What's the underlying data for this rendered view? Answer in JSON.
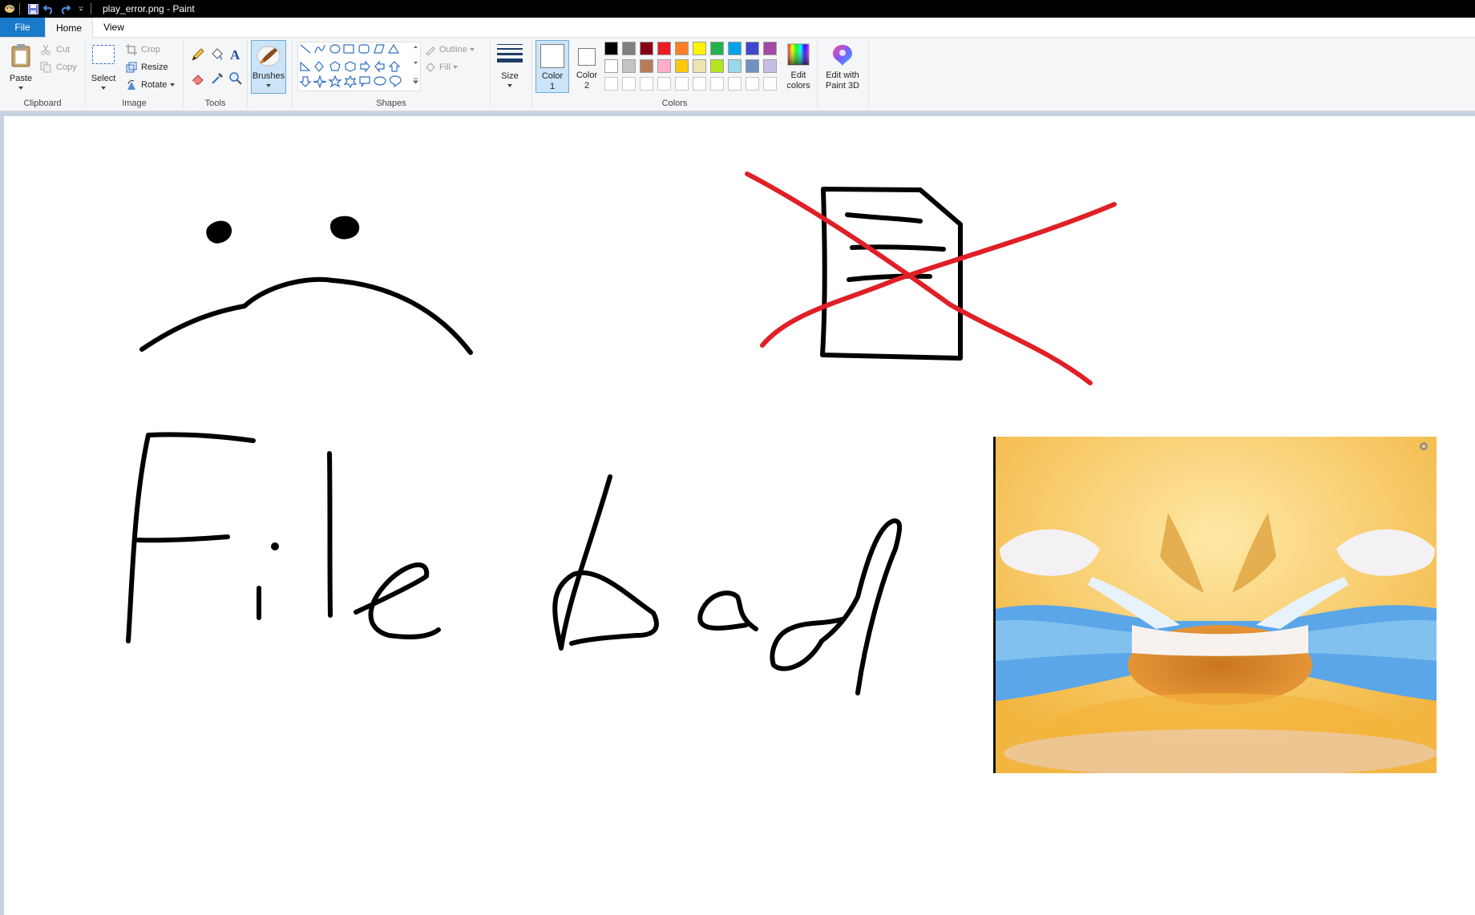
{
  "window": {
    "title": "play_error.png - Paint"
  },
  "tabs": {
    "file": "File",
    "home": "Home",
    "view": "View"
  },
  "clipboard": {
    "group_label": "Clipboard",
    "paste": "Paste",
    "cut": "Cut",
    "copy": "Copy"
  },
  "image": {
    "group_label": "Image",
    "select": "Select",
    "crop": "Crop",
    "resize": "Resize",
    "rotate": "Rotate"
  },
  "tools": {
    "group_label": "Tools"
  },
  "brushes": {
    "label": "Brushes"
  },
  "shapes": {
    "group_label": "Shapes",
    "outline": "Outline",
    "fill": "Fill"
  },
  "size": {
    "label": "Size"
  },
  "colors": {
    "group_label": "Colors",
    "color1_label": "Color",
    "color1_num": "1",
    "color2_label": "Color",
    "color2_num": "2",
    "edit_colors_line1": "Edit",
    "edit_colors_line2": "colors",
    "palette_row1": [
      "#000000",
      "#7f7f7f",
      "#880015",
      "#ed1c24",
      "#ff7f27",
      "#fff200",
      "#22b14c",
      "#00a2e8",
      "#3f48cc",
      "#a349a4"
    ],
    "palette_row2": [
      "#ffffff",
      "#c3c3c3",
      "#b97a57",
      "#ffaec9",
      "#ffc90e",
      "#efe4b0",
      "#b5e61d",
      "#99d9ea",
      "#7092be",
      "#c8bfe7"
    ]
  },
  "paint3d": {
    "line1": "Edit with",
    "line2": "Paint 3D"
  }
}
